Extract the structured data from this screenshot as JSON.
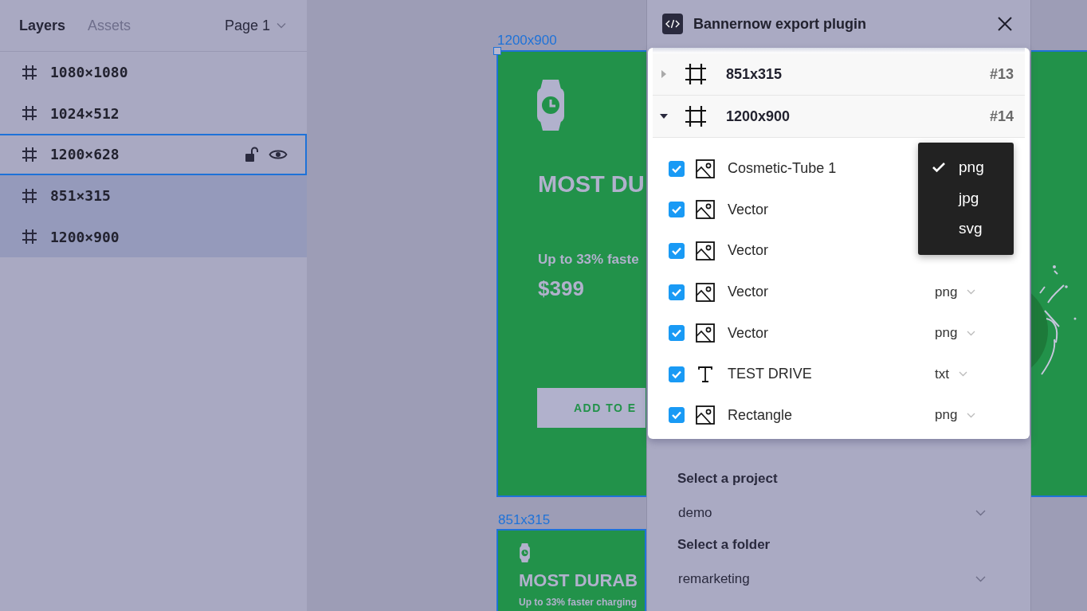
{
  "layers_panel": {
    "tabs": [
      {
        "label": "Layers",
        "selected": true
      },
      {
        "label": "Assets",
        "selected": false
      }
    ],
    "page_selector": "Page 1",
    "layers": [
      {
        "name": "1080×1080",
        "selected": false,
        "hovered": false
      },
      {
        "name": "1024×512",
        "selected": false,
        "hovered": false
      },
      {
        "name": "1200×628",
        "selected": false,
        "hovered": true
      },
      {
        "name": "851×315",
        "selected": true,
        "hovered": false
      },
      {
        "name": "1200×900",
        "selected": true,
        "hovered": false
      }
    ]
  },
  "canvas": {
    "frames": [
      {
        "kind": "large",
        "label": "1200x900",
        "selected": true,
        "heading": "MOST DU",
        "subheading": "Up to 33% faste",
        "price": "$399",
        "button": "ADD TO E"
      },
      {
        "kind": "small",
        "label": "851x315",
        "selected": false,
        "heading": "MOST DURAB",
        "subheading": "Up to 33% faster charging"
      }
    ]
  },
  "plugin": {
    "title": "Bannernow export plugin",
    "frames": [
      {
        "name": "851x315",
        "number": "#13",
        "expanded": false
      },
      {
        "name": "1200x900",
        "number": "#14",
        "expanded": true,
        "children": [
          {
            "kind": "image",
            "name": "Cosmetic-Tube 1",
            "checked": true
          },
          {
            "kind": "image",
            "name": "Vector",
            "checked": true
          },
          {
            "kind": "image",
            "name": "Vector",
            "checked": true
          },
          {
            "kind": "image",
            "name": "Vector",
            "checked": true,
            "format": "png"
          },
          {
            "kind": "image",
            "name": "Vector",
            "checked": true,
            "format": "png"
          },
          {
            "kind": "text",
            "name": "TEST DRIVE",
            "checked": true,
            "format": "txt"
          },
          {
            "kind": "image",
            "name": "Rectangle",
            "checked": true,
            "format": "png"
          }
        ]
      }
    ],
    "format_menu": [
      {
        "label": "png",
        "selected": true
      },
      {
        "label": "jpg",
        "selected": false
      },
      {
        "label": "svg",
        "selected": false
      }
    ],
    "project": {
      "label": "Select a project",
      "value": "demo"
    },
    "folder": {
      "label": "Select a folder",
      "value": "remarketing"
    }
  }
}
